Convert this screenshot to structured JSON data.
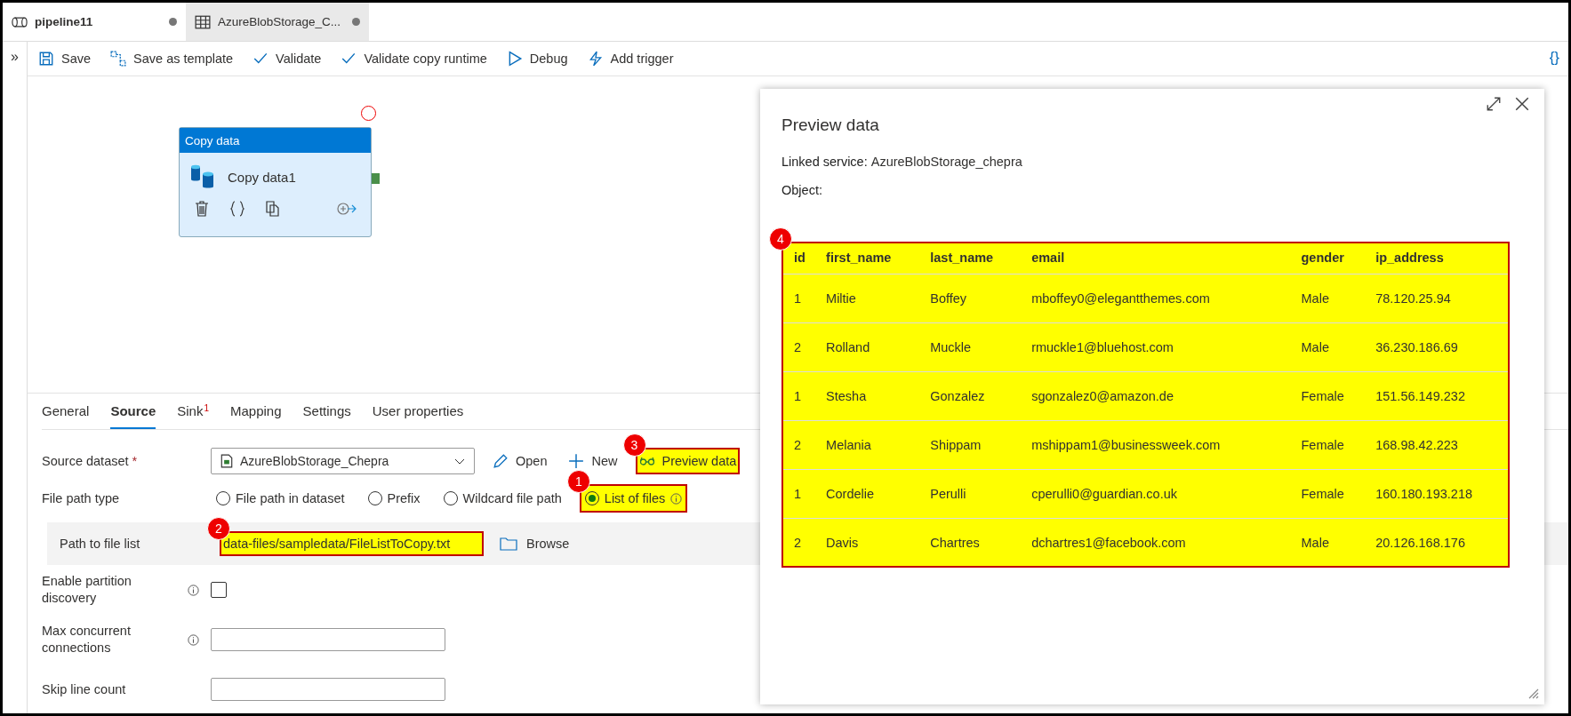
{
  "tabs": [
    {
      "label": "pipeline11",
      "selected": true,
      "kind": "pipeline",
      "unsaved": true
    },
    {
      "label": "AzureBlobStorage_C...",
      "selected": false,
      "kind": "dataset",
      "unsaved": true
    }
  ],
  "sidebar_toggle": "»",
  "toolbar": [
    {
      "label": "Save",
      "kind": "save"
    },
    {
      "label": "Save as template",
      "kind": "template"
    },
    {
      "label": "Validate",
      "kind": "check"
    },
    {
      "label": "Validate copy runtime",
      "kind": "check"
    },
    {
      "label": "Debug",
      "kind": "play"
    },
    {
      "label": "Add trigger",
      "kind": "trigger"
    }
  ],
  "code_button": "{}",
  "activity": {
    "type_label": "Copy data",
    "name": "Copy data1"
  },
  "properties": {
    "tabs": [
      {
        "label": "General",
        "selected": false
      },
      {
        "label": "Source",
        "selected": true
      },
      {
        "label": "Sink",
        "selected": false,
        "badge": "1"
      },
      {
        "label": "Mapping",
        "selected": false
      },
      {
        "label": "Settings",
        "selected": false
      },
      {
        "label": "User properties",
        "selected": false
      }
    ],
    "source_dataset": {
      "label": "Source dataset",
      "required": "*",
      "value": "AzureBlobStorage_Chepra",
      "actions": [
        {
          "label": "Open",
          "kind": "edit",
          "highlighted": false
        },
        {
          "label": "New",
          "kind": "add",
          "highlighted": false
        },
        {
          "label": "Preview data",
          "kind": "preview",
          "highlighted": true,
          "callout": "3"
        }
      ]
    },
    "file_path_type": {
      "label": "File path type",
      "options": [
        {
          "label": "File path in dataset",
          "selected": false,
          "highlighted": false,
          "info": false
        },
        {
          "label": "Prefix",
          "selected": false,
          "highlighted": false,
          "info": false
        },
        {
          "label": "Wildcard file path",
          "selected": false,
          "highlighted": false,
          "info": false
        },
        {
          "label": "List of files",
          "selected": true,
          "highlighted": true,
          "info": true,
          "callout": "1"
        }
      ]
    },
    "path_to_file_list": {
      "label": "Path to file list",
      "value": "data-files/sampledata/FileListToCopy.txt",
      "highlighted": true,
      "callout": "2",
      "browse": "Browse"
    },
    "fields": [
      {
        "label": "Enable partition discovery",
        "kind": "checkbox",
        "info": true,
        "checked": false
      },
      {
        "label": "Max concurrent connections",
        "kind": "text",
        "info": true
      },
      {
        "label": "Skip line count",
        "kind": "text",
        "info": false
      }
    ]
  },
  "preview": {
    "title": "Preview data",
    "linked_service_label": "Linked service:",
    "linked_service": "AzureBlobStorage_chepra",
    "object_label": "Object:",
    "highlighted": true,
    "callout": "4",
    "columns": [
      "id",
      "first_name",
      "last_name",
      "email",
      "gender",
      "ip_address"
    ],
    "rows": [
      [
        "1",
        "Miltie",
        "Boffey",
        "mboffey0@elegantthemes.com",
        "Male",
        "78.120.25.94"
      ],
      [
        "2",
        "Rolland",
        "Muckle",
        "rmuckle1@bluehost.com",
        "Male",
        "36.230.186.69"
      ],
      [
        "1",
        "Stesha",
        "Gonzalez",
        "sgonzalez0@amazon.de",
        "Female",
        "151.56.149.232"
      ],
      [
        "2",
        "Melania",
        "Shippam",
        "mshippam1@businessweek.com",
        "Female",
        "168.98.42.223"
      ],
      [
        "1",
        "Cordelie",
        "Perulli",
        "cperulli0@guardian.co.uk",
        "Female",
        "160.180.193.218"
      ],
      [
        "2",
        "Davis",
        "Chartres",
        "dchartres1@facebook.com",
        "Male",
        "20.126.168.176"
      ]
    ]
  }
}
